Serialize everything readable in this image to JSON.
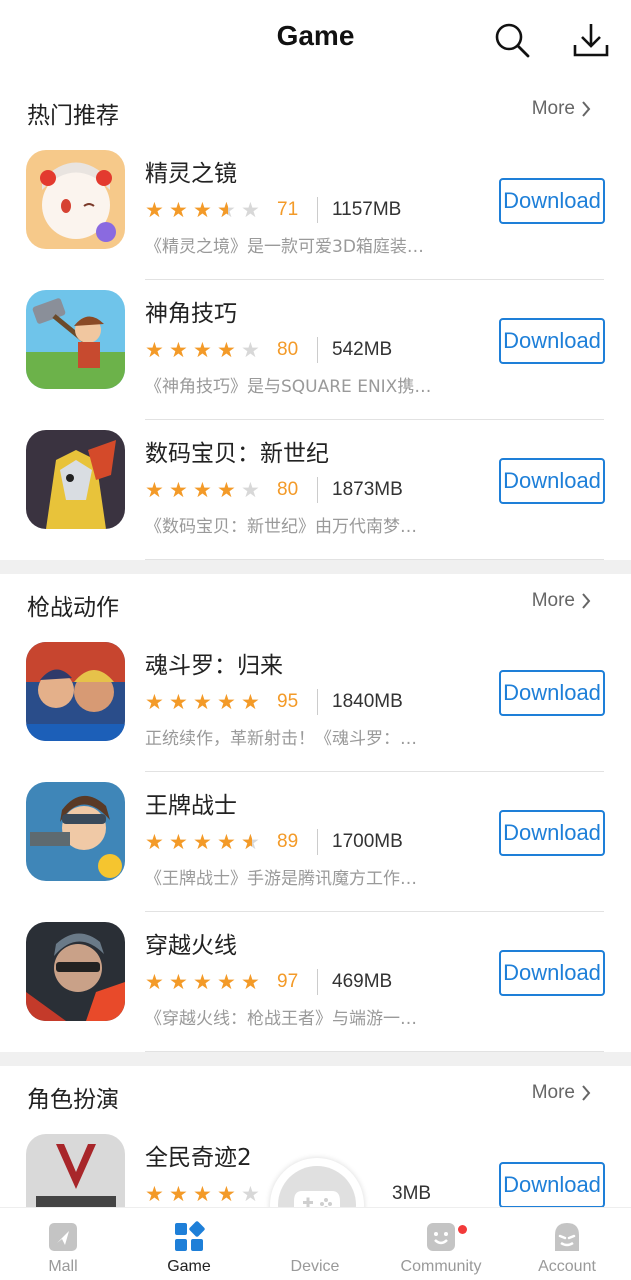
{
  "header": {
    "title": "Game"
  },
  "sections": [
    {
      "title": "热门推荐",
      "more_label": "More",
      "apps": [
        {
          "name": "精灵之镜",
          "rating": 3.5,
          "score": "71",
          "size": "1157MB",
          "desc": "《精灵之境》是一款可爱3D箱庭装…",
          "download_label": "Download",
          "icon": "anime-girl-icon"
        },
        {
          "name": "神角技巧",
          "rating": 4,
          "score": "80",
          "size": "542MB",
          "desc": "《神角技巧》是与SQUARE ENIX携…",
          "download_label": "Download",
          "icon": "hammer-hero-icon"
        },
        {
          "name": "数码宝贝：新世纪",
          "rating": 4,
          "score": "80",
          "size": "1873MB",
          "desc": "《数码宝贝：新世纪》由万代南梦…",
          "download_label": "Download",
          "icon": "digimon-icon"
        }
      ]
    },
    {
      "title": "枪战动作",
      "more_label": "More",
      "apps": [
        {
          "name": "魂斗罗：归来",
          "rating": 5,
          "score": "95",
          "size": "1840MB",
          "desc": "正统续作，革新射击！《魂斗罗：…",
          "download_label": "Download",
          "icon": "contra-icon"
        },
        {
          "name": "王牌战士",
          "rating": 4.5,
          "score": "89",
          "size": "1700MB",
          "desc": "《王牌战士》手游是腾讯魔方工作…",
          "download_label": "Download",
          "icon": "ace-soldier-icon"
        },
        {
          "name": "穿越火线",
          "rating": 5,
          "score": "97",
          "size": "469MB",
          "desc": "《穿越火线：枪战王者》与端游一…",
          "download_label": "Download",
          "icon": "crossfire-icon"
        }
      ]
    },
    {
      "title": "角色扮演",
      "more_label": "More",
      "apps": [
        {
          "name": "全民奇迹2",
          "rating": 4,
          "score": "",
          "size": "3MB",
          "desc": "",
          "download_label": "Download",
          "icon": "miracle-icon"
        }
      ]
    }
  ],
  "tabbar": {
    "tabs": [
      {
        "label": "Mall",
        "icon": "mall-icon",
        "active": false
      },
      {
        "label": "Game",
        "icon": "game-grid-icon",
        "active": true
      },
      {
        "label": "Device",
        "icon": "gamepad-icon",
        "active": false
      },
      {
        "label": "Community",
        "icon": "community-icon",
        "active": false
      },
      {
        "label": "Account",
        "icon": "account-icon",
        "active": false
      }
    ]
  },
  "colors": {
    "accent": "#1e7fd8",
    "star": "#f39a28",
    "badge": "#f23a3a"
  }
}
